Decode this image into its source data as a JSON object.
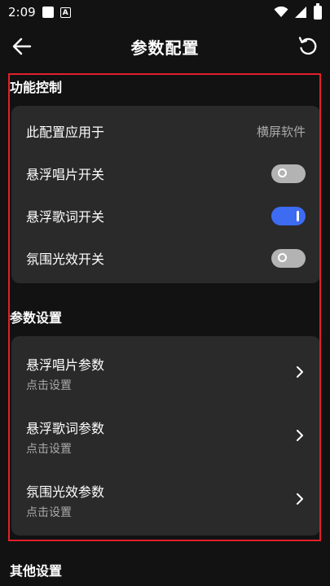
{
  "status_bar": {
    "time": "2:09"
  },
  "app_bar": {
    "title": "参数配置"
  },
  "sections": {
    "function_control": {
      "title": "功能控制",
      "apply_to": {
        "label": "此配置应用于",
        "value": "横屏软件"
      },
      "toggles": [
        {
          "label": "悬浮唱片开关",
          "state": "off"
        },
        {
          "label": "悬浮歌词开关",
          "state": "on"
        },
        {
          "label": "氛围光效开关",
          "state": "off"
        }
      ]
    },
    "param_settings": {
      "title": "参数设置",
      "items": [
        {
          "title": "悬浮唱片参数",
          "subtitle": "点击设置"
        },
        {
          "title": "悬浮歌词参数",
          "subtitle": "点击设置"
        },
        {
          "title": "氛围光效参数",
          "subtitle": "点击设置"
        }
      ]
    },
    "other_settings": {
      "title": "其他设置"
    }
  },
  "colors": {
    "accent": "#3d6cf2",
    "highlight_frame": "#e0202a",
    "card": "#2a2a2a",
    "background": "#121212"
  }
}
